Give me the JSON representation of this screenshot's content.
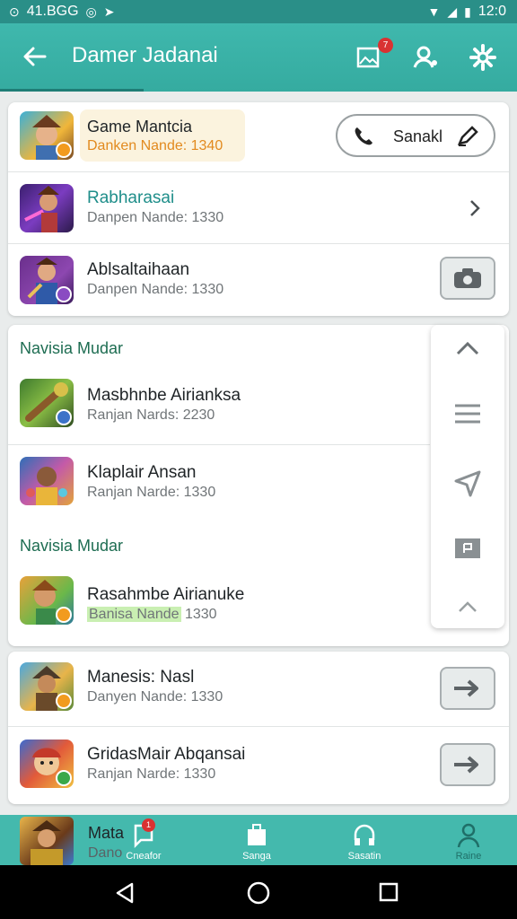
{
  "status_bar": {
    "left_text": "41.BGG",
    "time": "12:0"
  },
  "app_bar": {
    "title": "Damer Jadanai",
    "notification_count": "7"
  },
  "card1": {
    "rows": [
      {
        "name": "Game Mantcia",
        "sub": "Danken Nande: 1340",
        "action": "Sanakl"
      },
      {
        "name": "Rabharasai",
        "sub": "Danpen Nande: 1330"
      },
      {
        "name": "Ablsaltaihaan",
        "sub": "Danpen Nande: 1330"
      }
    ]
  },
  "section1": {
    "header": "Navisia Mudar"
  },
  "card2_rows": [
    {
      "name": "Masbhnbe Airianksa",
      "sub": "Ranjan Nards: 2230"
    },
    {
      "name": "Klaplair Ansan",
      "sub": "Ranjan Narde: 1330"
    }
  ],
  "section2": {
    "header": "Navisia Mudar"
  },
  "card2_row3": {
    "name": "Rasahmbe Airianuke",
    "sub_highlight": "Banisa Nande",
    "sub_rest": " 1330"
  },
  "card3": {
    "rows": [
      {
        "name": "Manesis: Nasl",
        "sub": "Danyen Nande: 1330"
      },
      {
        "name": "GridasMair Abqansai",
        "sub": "Ranjan Narde: 1330"
      }
    ]
  },
  "peek_row": {
    "name": "Mata",
    "sub": "Dano"
  },
  "bottom_nav": {
    "items": [
      {
        "label": "Cneafor"
      },
      {
        "label": "Sanga"
      },
      {
        "label": "Sasatin"
      },
      {
        "label": "Raine"
      }
    ],
    "badge": "1"
  },
  "colors": {
    "primary": "#3fb8ad",
    "accent_green": "#1e6d52",
    "highlight_green": "#c9efb2",
    "highlight_yellow": "#fbf3de"
  }
}
